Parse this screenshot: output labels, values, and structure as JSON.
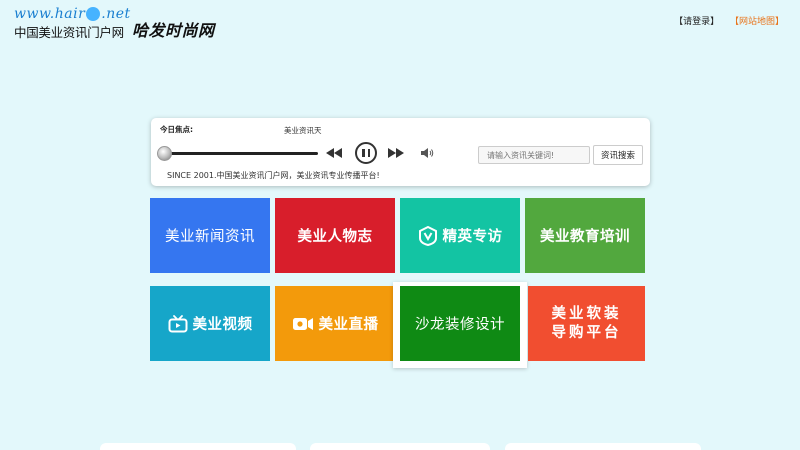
{
  "header": {
    "logo_url": "www.hair",
    "logo_url_net": ".net",
    "logo_cn": "中国美业资讯门户网",
    "slogan": "哈发时尚网",
    "login": "【请登录】",
    "sitemap": "【网站地图】"
  },
  "player": {
    "focus_label": "今日焦点:",
    "focus_text": "美业资讯天",
    "progress": 0,
    "search_placeholder": "请输入资讯关键词!",
    "search_button": "资讯搜索",
    "tagline": "SINCE 2001.中国美业资讯门户网，美业资讯专业传播平台!"
  },
  "tiles": [
    {
      "label": "美业新闻资讯",
      "color": "#3576f0"
    },
    {
      "label": "美业人物志",
      "color": "#d81e2b"
    },
    {
      "label": "精英专访",
      "color": "#13c4a3",
      "icon": "v-badge-icon"
    },
    {
      "label": "美业教育培训",
      "color": "#52a83e"
    },
    {
      "label": "美业视频",
      "color": "#16a6c9",
      "icon": "tv-icon"
    },
    {
      "label": "美业直播",
      "color": "#f39a0b",
      "icon": "camera-icon"
    },
    {
      "label": "沙龙装修设计",
      "color": "#0f8a14"
    },
    {
      "label_line1": "美业软装",
      "label_line2": "导购平台",
      "color": "#f14e30"
    }
  ]
}
